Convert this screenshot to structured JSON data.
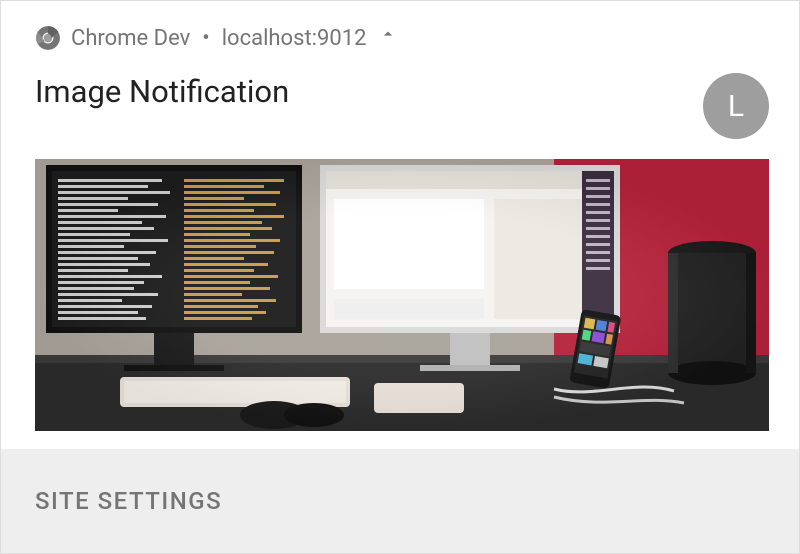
{
  "header": {
    "app_name": "Chrome Dev",
    "separator": "•",
    "origin": "localhost:9012"
  },
  "notification": {
    "title": "Image Notification"
  },
  "badge": {
    "letter": "L"
  },
  "actions": {
    "site_settings": "SITE SETTINGS"
  }
}
